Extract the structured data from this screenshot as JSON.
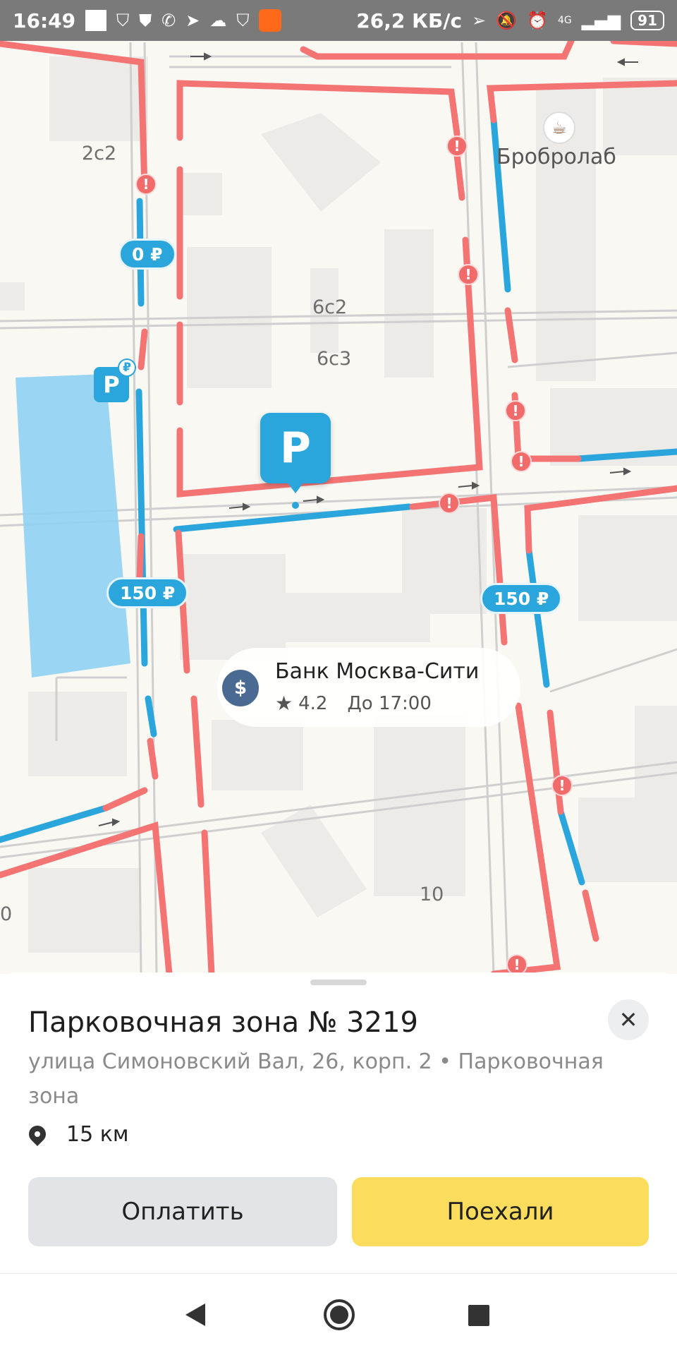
{
  "status_bar": {
    "time": "16:49",
    "network_speed": "26,2 КБ/с",
    "network_type": "4G",
    "battery": "91",
    "left_icons": [
      "white-square-icon",
      "shield-bolt-icon",
      "shield-check-icon",
      "whatsapp-icon",
      "navigation-arrow-icon",
      "cloud-icon",
      "shield-icon",
      "app-orange-icon"
    ],
    "right_icons": [
      "location-arrow-icon",
      "mute-bell-icon",
      "alarm-icon",
      "signal-icon"
    ]
  },
  "map": {
    "building_labels": [
      "2с2",
      "6с2",
      "6с3",
      "10",
      "0"
    ],
    "price_pills": [
      "0 ₽",
      "150 ₽",
      "150 ₽"
    ],
    "parking_marker": "P",
    "small_parking": {
      "letter": "P",
      "badge": "₽"
    },
    "alert_symbol": "!",
    "cafe": {
      "name": "Бробролаб",
      "icon": "coffee-cup-icon"
    },
    "poi": {
      "name": "Банк Москва-Сити",
      "rating": "4.2",
      "hours": "До 17:00",
      "icon": "bank-icon"
    },
    "colors": {
      "paid_road": "#2aa6dd",
      "no_parking_road": "#f47474",
      "parking_area": "#8fd1f3",
      "background": "#faf8f3",
      "building": "#ececea"
    }
  },
  "sheet": {
    "title": "Парковочная зона № 3219",
    "address": "улица Симоновский Вал, 26, корп. 2 • Парковочная зона",
    "distance": "15 км",
    "pay_button": "Оплатить",
    "go_button": "Поехали",
    "close_icon": "close-icon"
  },
  "nav_bar": {
    "back": "back-icon",
    "home": "home-icon",
    "recents": "recents-icon"
  }
}
